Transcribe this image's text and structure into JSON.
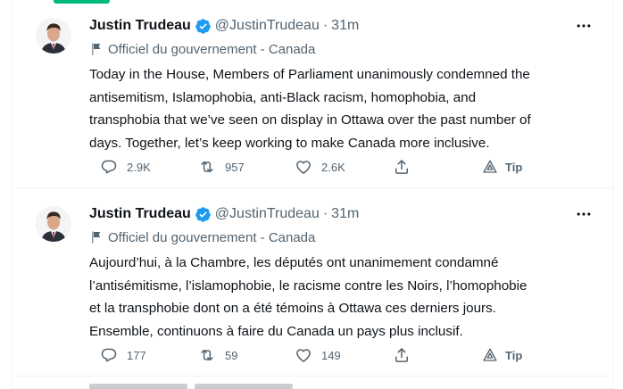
{
  "colors": {
    "accent": "#1d9bf0",
    "secondary_text": "#536471",
    "primary_text": "#0f1419",
    "divider": "#eff3f4",
    "top_accent": "#00ba7c"
  },
  "tweets": [
    {
      "name": "Justin Trudeau",
      "handle": "@JustinTrudeau",
      "separator": "·",
      "time": "31m",
      "label": "Officiel du gouvernement - Canada",
      "body_lines": [
        "Today in the House, Members of Parliament unanimously condemned the",
        "antisemitism, Islamophobia, anti-Black racism, homophobia, and",
        "transphobia that we’ve seen on display in Ottawa over the past number of",
        "days. Together, let’s keep working to make Canada more inclusive."
      ],
      "replies": "2.9K",
      "retweets": "957",
      "likes": "2.6K",
      "tip": "Tip"
    },
    {
      "name": "Justin Trudeau",
      "handle": "@JustinTrudeau",
      "separator": "·",
      "time": "31m",
      "label": "Officiel du gouvernement - Canada",
      "body_lines": [
        "Aujourd’hui, à la Chambre, les députés ont unanimement condamné",
        "l’antisémitisme, l’islamophobie, le racisme contre les Noirs, l’homophobie",
        "et la transphobie dont on a été témoins à Ottawa ces derniers jours.",
        "Ensemble, continuons à faire du Canada un pays plus inclusif."
      ],
      "replies": "177",
      "retweets": "59",
      "likes": "149",
      "tip": "Tip"
    }
  ],
  "icons": {
    "verified": "verified-badge-icon",
    "government_flag": "flag-icon",
    "more": "more-icon",
    "reply": "reply-icon",
    "retweet": "retweet-icon",
    "like": "heart-icon",
    "share": "share-icon",
    "tip": "tip-icon"
  }
}
